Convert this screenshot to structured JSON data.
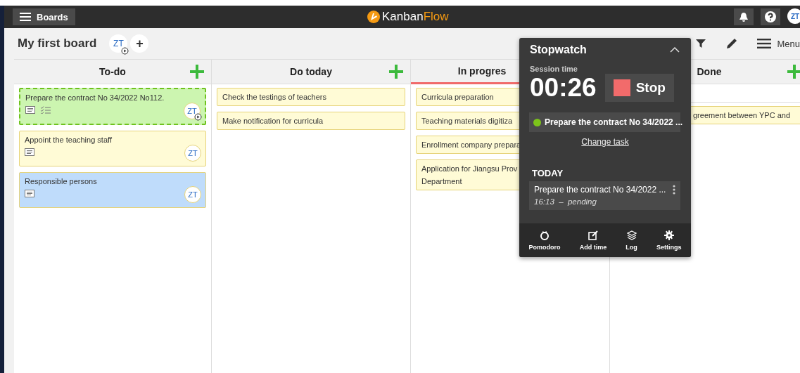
{
  "topbar": {
    "boards_button": "Boards",
    "logo_a": "Kanban",
    "logo_b": "Flow",
    "user": "ZT"
  },
  "board": {
    "title": "My first board",
    "member": "ZT",
    "add_member": "+",
    "menu": "Menu"
  },
  "columns": [
    {
      "name": "To-do",
      "wip": false,
      "add": true,
      "cards": [
        {
          "text": "Prepare the contract No 34/2022 No112.",
          "color": "#ccf5b0",
          "timing": true,
          "checklist": true,
          "avatar": "ZT"
        },
        {
          "text": "Appoint the teaching staff",
          "color": "#fffbd6",
          "timing": false,
          "checklist": false,
          "avatar": "ZT"
        },
        {
          "text": "Responsible persons",
          "color": "#bfdcfb",
          "timing": false,
          "checklist": false,
          "avatar": "ZT"
        }
      ]
    },
    {
      "name": "Do today",
      "wip": false,
      "add": true,
      "cards": [
        {
          "text": "Check the testings of teachers",
          "color": "#fffbd6"
        },
        {
          "text": "Make notification for curricula",
          "color": "#fffbd6"
        }
      ]
    },
    {
      "name": "In progres",
      "wip": true,
      "add": false,
      "cards": [
        {
          "text": "Curricula preparation",
          "color": "#fffbd6"
        },
        {
          "text": "Teaching materials digitiza",
          "color": "#fffbd6"
        },
        {
          "text": "Enrollment company prepara",
          "color": "#fffbd6"
        },
        {
          "text": "Application for Jiangsu Prov",
          "text2": "Department",
          "color": "#fffbd6"
        }
      ]
    },
    {
      "name": "Done",
      "wip": false,
      "add": true,
      "cards": [
        {
          "text": "greement between YPC and",
          "color": "#fffbd6"
        }
      ]
    }
  ],
  "stopwatch": {
    "title": "Stopwatch",
    "label": "Session time",
    "time": "00:26",
    "stop": "Stop",
    "task": {
      "name": "Prepare the contract No 34/2022 ...",
      "color": "#7cc31a"
    },
    "change": "Change task",
    "today": "TODAY",
    "entries": [
      {
        "task": "Prepare the contract No 34/2022 ...",
        "time": "16:13",
        "dash": "–",
        "status": "pending"
      }
    ],
    "actions": [
      {
        "kind": "pomodoro",
        "label": "Pomodoro"
      },
      {
        "kind": "add",
        "label": "Add time"
      },
      {
        "kind": "log",
        "label": "Log"
      },
      {
        "kind": "settings",
        "label": "Settings"
      }
    ]
  }
}
